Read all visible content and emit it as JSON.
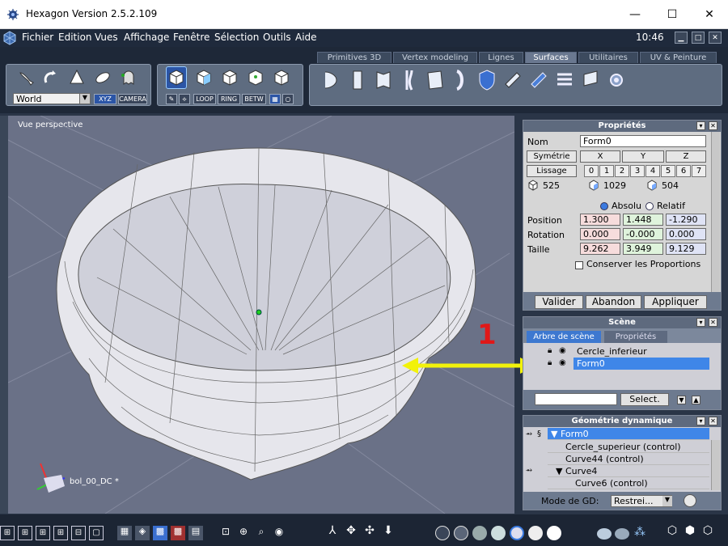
{
  "window": {
    "title": "Hexagon Version 2.5.2.109",
    "minimize": "—",
    "maximize": "☐",
    "close": "✕"
  },
  "menu": {
    "items": [
      "Fichier",
      "Edition",
      "Vues",
      "Affichage",
      "Fenêtre",
      "Sélection",
      "Outils",
      "Aide"
    ],
    "clock": "10:46"
  },
  "tabs": [
    "Primitives 3D",
    "Vertex modeling",
    "Lignes",
    "Surfaces",
    "Utilitaires",
    "UV & Peinture"
  ],
  "active_tab": "Surfaces",
  "toolbar": {
    "world_select": "World",
    "xyz": "XYZ",
    "camera": "CAMERA",
    "loop": "LOOP",
    "ring": "RING",
    "betw": "BETW"
  },
  "viewport": {
    "label": "Vue perspective",
    "object_label": "bol_00_DC *"
  },
  "annotation": {
    "number": "1",
    "color": "#f2f20a"
  },
  "properties": {
    "title": "Propriétés",
    "nom_label": "Nom",
    "nom_value": "Form0",
    "symetrie": "Symétrie",
    "x": "X",
    "y": "Y",
    "z": "Z",
    "lissage": "Lissage",
    "levels": [
      "0",
      "1",
      "2",
      "3",
      "4",
      "5",
      "6",
      "7"
    ],
    "counts": [
      "525",
      "1029",
      "504"
    ],
    "absolu": "Absolu",
    "relatif": "Relatif",
    "position_label": "Position",
    "position": [
      "1.300",
      "1.448",
      "-1.290"
    ],
    "rotation_label": "Rotation",
    "rotation": [
      "0.000",
      "-0.000",
      "0.000"
    ],
    "taille_label": "Taille",
    "taille": [
      "9.262",
      "3.949",
      "9.129"
    ],
    "conserver": "Conserver les Proportions",
    "valider": "Valider",
    "abandon": "Abandon",
    "appliquer": "Appliquer"
  },
  "scene": {
    "title": "Scène",
    "tab1": "Arbre de scène",
    "tab2": "Propriétés",
    "items": [
      "Cercle_inferieur",
      "Form0"
    ],
    "select_btn": "Select."
  },
  "geometry": {
    "title": "Géométrie dynamique",
    "rows": [
      "Form0",
      "Cercle_superieur (control)",
      "Curve44 (control)",
      "Curve4",
      "Curve6 (control)"
    ],
    "mode_label": "Mode de GD:",
    "mode_value": "Restrei..."
  }
}
